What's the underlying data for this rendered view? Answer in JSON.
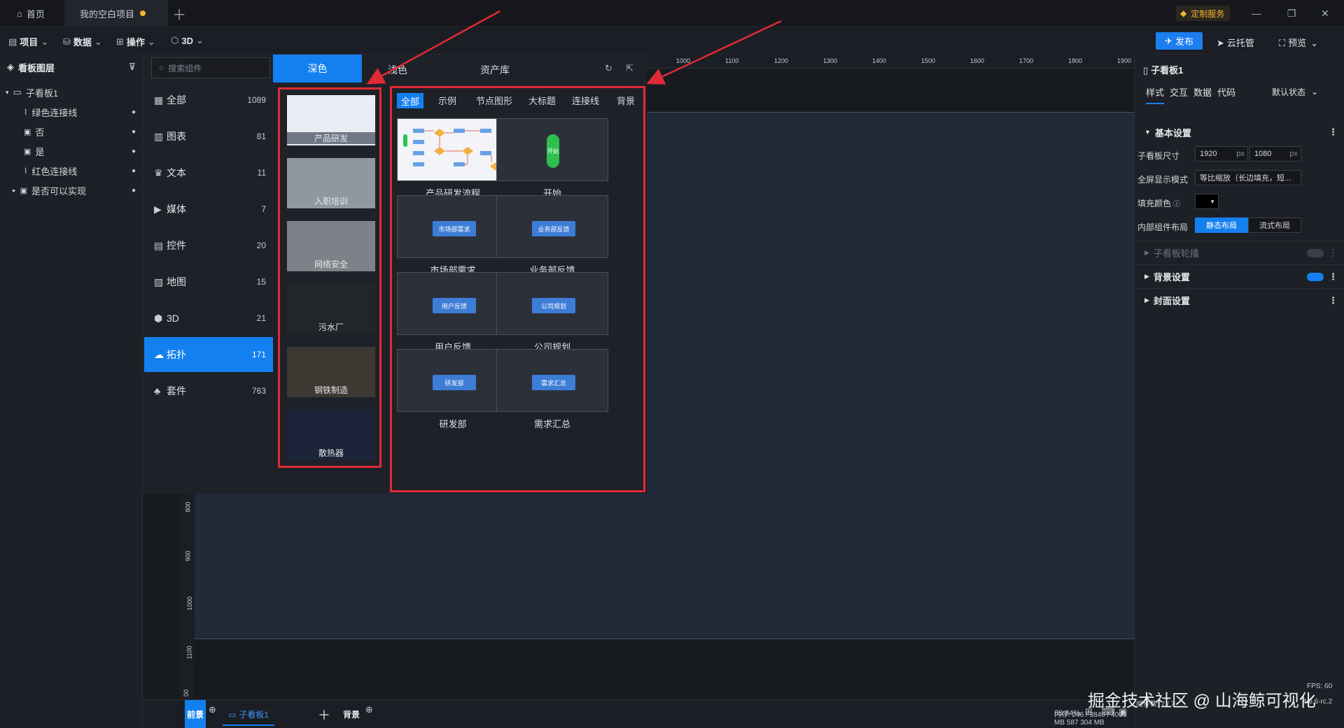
{
  "titlebar": {
    "home_tab": "首页",
    "project_tab": "我的空白项目",
    "custom_service": "定制服务",
    "win_controls": [
      "—",
      "❐",
      "✕"
    ]
  },
  "menubar": {
    "items": [
      "项目",
      "数据",
      "操作",
      "3D"
    ],
    "publish": "发布",
    "cloud": "云托管",
    "preview": "预览"
  },
  "layers": {
    "title": "看板图层",
    "items": [
      "子看板1",
      "绿色连接线",
      "否",
      "是",
      "红色连接线",
      "是否可以实现"
    ]
  },
  "components": {
    "search_placeholder": "搜索组件",
    "theme_tabs": [
      "深色",
      "浅色",
      "资产库"
    ],
    "categories": [
      {
        "label": "全部",
        "count": "1089"
      },
      {
        "label": "图表",
        "count": "81"
      },
      {
        "label": "文本",
        "count": "11"
      },
      {
        "label": "媒体",
        "count": "7"
      },
      {
        "label": "控件",
        "count": "20"
      },
      {
        "label": "地图",
        "count": "15"
      },
      {
        "label": "3D",
        "count": "21"
      },
      {
        "label": "拓扑",
        "count": "171"
      },
      {
        "label": "套件",
        "count": "763"
      }
    ],
    "themes": [
      "产品研发",
      "入职培训",
      "网络安全",
      "污水厂",
      "钢铁制造",
      "散热器"
    ],
    "sub_tabs": [
      "全部",
      "示例",
      "节点图形",
      "大标题",
      "连接线",
      "背景"
    ],
    "cards": [
      {
        "label": "产品研发流程",
        "btn": ""
      },
      {
        "label": "开始",
        "btn": "开始"
      },
      {
        "label": "市场部需求",
        "btn": "市场部需求"
      },
      {
        "label": "业务部反馈",
        "btn": "业务部反馈"
      },
      {
        "label": "用户反馈",
        "btn": "用户反馈"
      },
      {
        "label": "公司规划",
        "btn": "公司规划"
      },
      {
        "label": "研发部",
        "btn": "研发部"
      },
      {
        "label": "需求汇总",
        "btn": "需求汇总"
      }
    ]
  },
  "ruler": {
    "top": [
      "1000",
      "1100",
      "1200",
      "1300",
      "1400",
      "1500",
      "1600",
      "1700",
      "1800",
      "1900"
    ],
    "left": [
      "800",
      "900",
      "1000",
      "1100",
      "00"
    ]
  },
  "bottombar": {
    "front": "前景",
    "board_tab": "子看板1",
    "background": "背景",
    "zoom": "69.84%",
    "stats": "内存: 246 / 3840 / 4096 MB  587 304 MB",
    "fps": "FPS: 60",
    "count": "组件数: 7 / 7",
    "version": "4.6.6-rc.2"
  },
  "props": {
    "title": "子看板1",
    "tabs": [
      "样式",
      "交互",
      "数据",
      "代码"
    ],
    "state": "默认状态",
    "basic": "基本设置",
    "size_label": "子看板尺寸",
    "width": "1920",
    "height": "1080",
    "unit": "px",
    "fullscreen_label": "全屏显示模式",
    "fullscreen_value": "等比缩放（长边填充，短...",
    "fill_label": "填充颜色",
    "layout_label": "内部组件布局",
    "layout_static": "静态布局",
    "layout_flow": "流式布局",
    "carousel": "子看板轮播",
    "bg_settings": "背景设置",
    "cover_settings": "封面设置"
  },
  "watermark": "掘金技术社区 @ 山海鲸可视化",
  "colors": {
    "accent": "#1480f0",
    "highlight": "#e02a36"
  }
}
